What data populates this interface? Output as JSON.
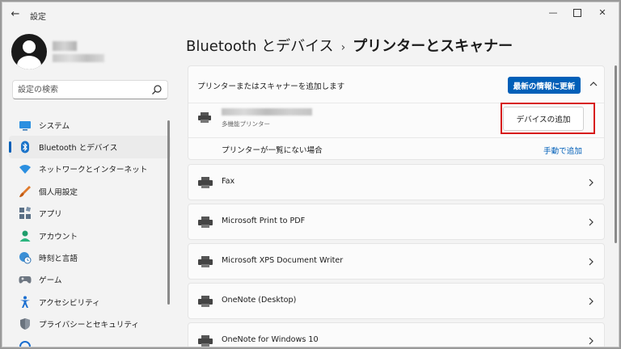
{
  "window": {
    "app_title": "設定",
    "back_glyph": "←",
    "min_glyph": "—",
    "close_glyph": "✕"
  },
  "search": {
    "placeholder": "設定の検索"
  },
  "nav": {
    "items": [
      {
        "label": "システム",
        "icon": "display-icon"
      },
      {
        "label": "Bluetooth とデバイス",
        "icon": "bluetooth-icon",
        "selected": true
      },
      {
        "label": "ネットワークとインターネット",
        "icon": "wifi-icon"
      },
      {
        "label": "個人用設定",
        "icon": "brush-icon"
      },
      {
        "label": "アプリ",
        "icon": "apps-icon"
      },
      {
        "label": "アカウント",
        "icon": "person-icon"
      },
      {
        "label": "時刻と言語",
        "icon": "globe-clock-icon"
      },
      {
        "label": "ゲーム",
        "icon": "gamepad-icon"
      },
      {
        "label": "アクセシビリティ",
        "icon": "accessibility-icon"
      },
      {
        "label": "プライバシーとセキュリティ",
        "icon": "shield-icon"
      }
    ]
  },
  "breadcrumb": {
    "parent": "Bluetooth とデバイス",
    "separator": "›",
    "current": "プリンターとスキャナー"
  },
  "add_section": {
    "header_label": "プリンターまたはスキャナーを追加します",
    "refresh_label": "最新の情報に更新",
    "found_device_subtitle": "多機能プリンター",
    "add_device_label": "デバイスの追加",
    "not_listed_label": "プリンターが一覧にない場合",
    "manual_add_label": "手動で追加"
  },
  "printers": [
    {
      "name": "Fax"
    },
    {
      "name": "Microsoft Print to PDF"
    },
    {
      "name": "Microsoft XPS Document Writer"
    },
    {
      "name": "OneNote (Desktop)"
    },
    {
      "name": "OneNote for Windows 10"
    }
  ],
  "colors": {
    "accent": "#005fb8",
    "highlight": "#d71a1a"
  }
}
